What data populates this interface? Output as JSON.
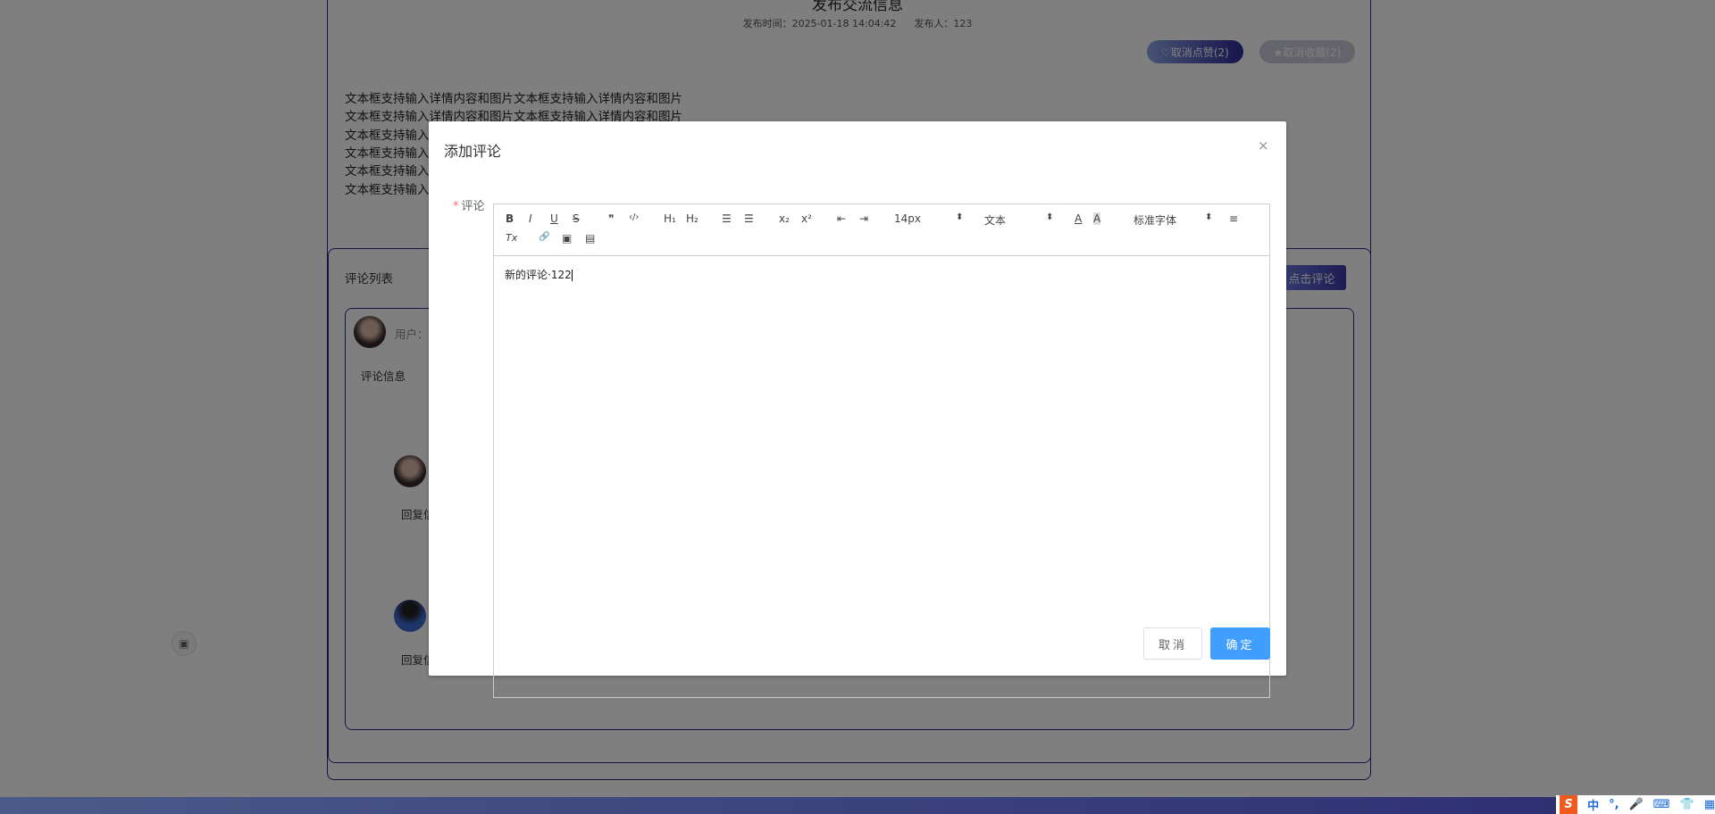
{
  "post": {
    "title": "发布交流信息",
    "time_label": "发布时间：2025-01-18 14:04:42",
    "author_label": "发布人：123",
    "like_button": "♡取消点赞(2)",
    "favorite_button": "★取消收藏(2)",
    "content_lines": [
      "文本框支持输入详情内容和图片文本框支持输入详情内容和图片",
      "文本框支持输入详情内容和图片文本框支持输入详情内容和图片",
      "文本框支持输入",
      "文本框支持输入",
      "文本框支持输入",
      "文本框支持输入"
    ]
  },
  "comments": {
    "title": "评论列表",
    "add_button": "点击评论",
    "user_label": "用户：",
    "comment_text": "评论信息",
    "reply_1": "回复信",
    "reply_2": "回复信"
  },
  "modal": {
    "title": "添加评论",
    "close": "×",
    "field_label": "评论",
    "required_mark": "*",
    "toolbar": {
      "bold": "B",
      "italic": "I",
      "underline": "U",
      "strike": "S",
      "quote": "❞",
      "code": "‹/›",
      "h1": "H₁",
      "h2": "H₂",
      "ordered_list": "☰",
      "bullet_list": "☰",
      "subscript": "x₂",
      "superscript": "x²",
      "outdent": "⇤",
      "indent": "⇥",
      "size": "14px",
      "header": "文本",
      "color": "A",
      "background": "A",
      "font": "标准字体",
      "align": "≡",
      "clean": "Tx",
      "link": "🔗",
      "image": "▣",
      "video": "▤",
      "select_arrow": "⬍"
    },
    "editor_value": "新的评论·122",
    "cancel": "取消",
    "confirm": "确定"
  },
  "taskbar": {
    "ime_logo": "S",
    "ime_mode": "中",
    "punct": "°,",
    "mic": "🎤",
    "keyboard": "⌨",
    "skin": "👕",
    "menu": "▦"
  }
}
